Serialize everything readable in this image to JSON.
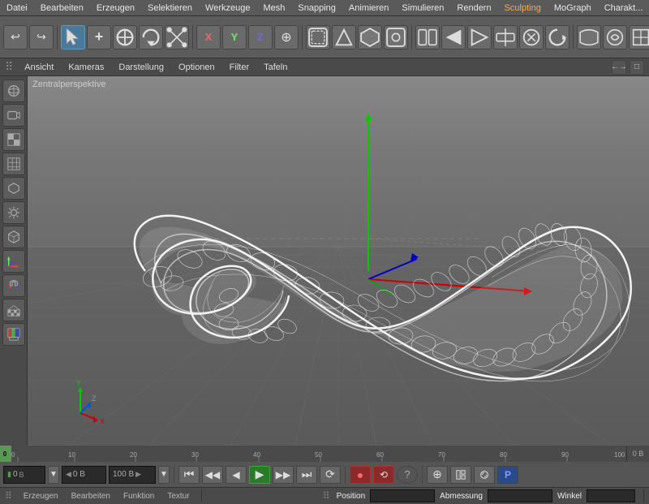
{
  "menubar": {
    "items": [
      "Datei",
      "Bearbeiten",
      "Erzeugen",
      "Selektieren",
      "Werkzeuge",
      "Mesh",
      "Snapping",
      "Animieren",
      "Simulieren",
      "Rendern",
      "Sculpting",
      "MoGraph",
      "Charakt..."
    ]
  },
  "toolbar": {
    "groups": [
      {
        "id": "undo",
        "buttons": [
          "↩",
          "↪"
        ]
      },
      {
        "id": "select",
        "buttons": [
          "▶",
          "+",
          "⬡",
          "⟳",
          "⟲"
        ]
      },
      {
        "id": "axis",
        "buttons": [
          "X",
          "Y",
          "Z",
          "⊕"
        ]
      },
      {
        "id": "transform",
        "buttons": [
          "⬜",
          "⬜",
          "▷",
          "⬜"
        ]
      },
      {
        "id": "anim",
        "buttons": [
          "⬜",
          "⬜",
          "⬜",
          "⬜",
          "⬜",
          "⬜"
        ]
      },
      {
        "id": "shape",
        "buttons": [
          "⬡",
          "↺",
          "⬜",
          "⬡"
        ]
      },
      {
        "id": "extra",
        "buttons": [
          "⬜",
          "⬜"
        ]
      }
    ]
  },
  "viewport": {
    "label": "Zentralperspektive",
    "topbar_menus": [
      "Ansicht",
      "Kameras",
      "Darstellung",
      "Optionen",
      "Filter",
      "Tafeln"
    ]
  },
  "timeline": {
    "start": 0,
    "end": 100,
    "current": 0,
    "ticks": [
      0,
      10,
      20,
      30,
      40,
      50,
      60,
      70,
      80,
      90,
      100
    ]
  },
  "transport": {
    "fields": [
      "0 B",
      "◀ 0 B",
      "100 B ▶"
    ],
    "end_label": "0 B",
    "buttons": [
      "⏮",
      "◀◀",
      "◀",
      "▶",
      "▶▶",
      "⏭",
      "⟳"
    ],
    "record_buttons": [
      "●",
      "⟲",
      "?"
    ],
    "extra_buttons": [
      "⊕",
      "⬜",
      "⟳",
      "🅿"
    ]
  },
  "statusbar": {
    "left_menus": [
      "Erzeugen",
      "Bearbeiten",
      "Funktion",
      "Textur"
    ],
    "right_labels": [
      "Position",
      "Abmessung",
      "Winkel"
    ]
  },
  "icons": {
    "cursor": "▶",
    "move": "✛",
    "rotate": "⟳",
    "scale": "⤢",
    "undo": "↩",
    "redo": "↪"
  }
}
